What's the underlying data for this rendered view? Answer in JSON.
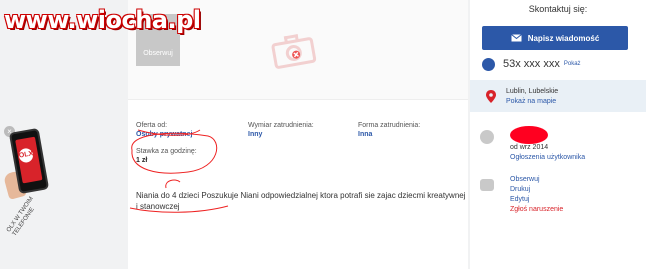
{
  "watermark": "www.wiocha.pl",
  "promo": {
    "close": "×",
    "logo": "OLX",
    "caption": "OLX W TWOIM TELEFONIE"
  },
  "gallery": {
    "observe_label": "Obserwuj"
  },
  "details": {
    "offer_from": {
      "label": "Oferta od:",
      "value": "Osoby prywatnej"
    },
    "work_time": {
      "label": "Wymiar zatrudnienia:",
      "value": "Inny"
    },
    "employment": {
      "label": "Forma zatrudnienia:",
      "value": "Inna"
    },
    "hourly_rate": {
      "label": "Stawka za godzinę:",
      "value": "1 zł"
    }
  },
  "description": "Niania do 4 dzieci Poszukuje Niani odpowiedzialnej ktora potrafi sie zajac dziecmi kreatywnej i stanowczej",
  "contact": {
    "title": "Skontaktuj się:",
    "message_button": "Napisz wiadomość",
    "phone": "53x xxx xxx",
    "show": "Pokaż",
    "location": "Lublin, Lubelskie",
    "show_map": "Pokaż na mapie",
    "user_since": "od wrz 2014",
    "user_ads": "Ogłoszenia użytkownika",
    "actions": [
      "Obserwuj",
      "Drukuj",
      "Edytuj",
      "Zgłoś naruszenie"
    ]
  },
  "colors": {
    "brand": "#2c58a8",
    "accent_red": "#d8232a",
    "annotation": "#ff0020"
  }
}
